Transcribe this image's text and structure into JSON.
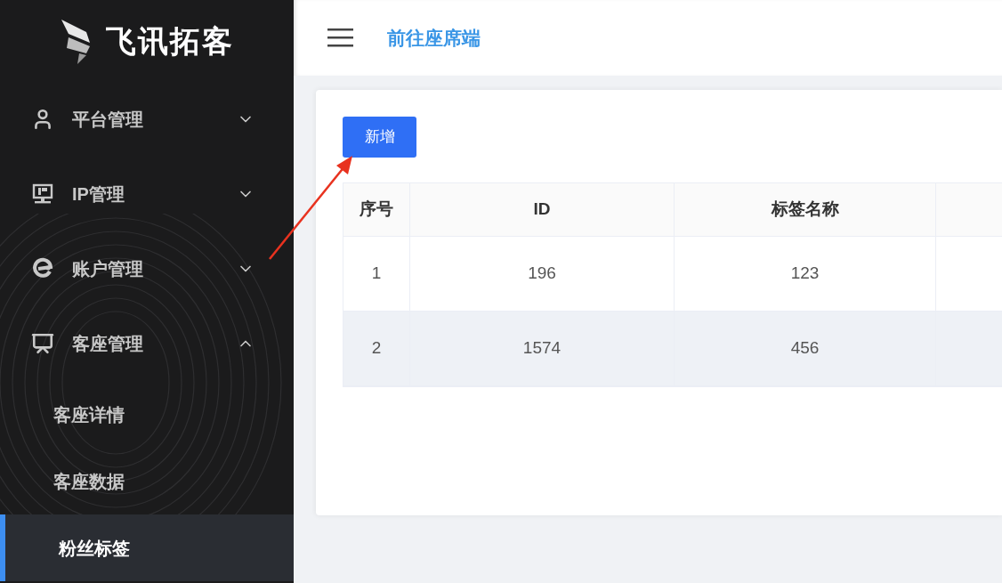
{
  "sidebar": {
    "logo": "飞讯拓客",
    "items": [
      {
        "kind": "user",
        "label": "平台管理",
        "expanded": false
      },
      {
        "kind": "ip",
        "label": "IP管理",
        "expanded": false
      },
      {
        "kind": "account",
        "label": "账户管理",
        "expanded": false
      },
      {
        "kind": "seat",
        "label": "客座管理",
        "expanded": true,
        "children": [
          {
            "label": "客座详情",
            "selected": false
          },
          {
            "label": "客座数据",
            "selected": false
          },
          {
            "label": "粉丝标签",
            "selected": true
          }
        ]
      }
    ]
  },
  "header": {
    "link": "前往座席端"
  },
  "toolbar": {
    "add_button": "新增"
  },
  "table": {
    "columns": [
      "序号",
      "ID",
      "标签名称"
    ],
    "rows": [
      {
        "cells": [
          "1",
          "196",
          "123"
        ],
        "highlighted": false
      },
      {
        "cells": [
          "2",
          "1574",
          "456"
        ],
        "highlighted": true
      }
    ]
  }
}
